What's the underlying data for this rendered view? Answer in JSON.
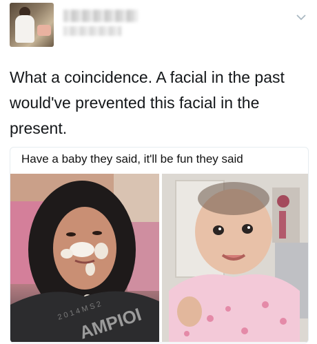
{
  "tweet": {
    "text": "What a coincidence. A facial in the past would've prevented this facial in the present."
  },
  "meme": {
    "caption": "Have a baby they said, it'll be fun they said",
    "shirt_text": "2 0 1 4   M S 2",
    "shirt_brand": "AMPIOI"
  },
  "icons": {
    "menu": "chevron-down-icon"
  },
  "colors": {
    "text": "#14171a",
    "icon": "#aab8c2",
    "card_border": "#e6ecf0"
  }
}
